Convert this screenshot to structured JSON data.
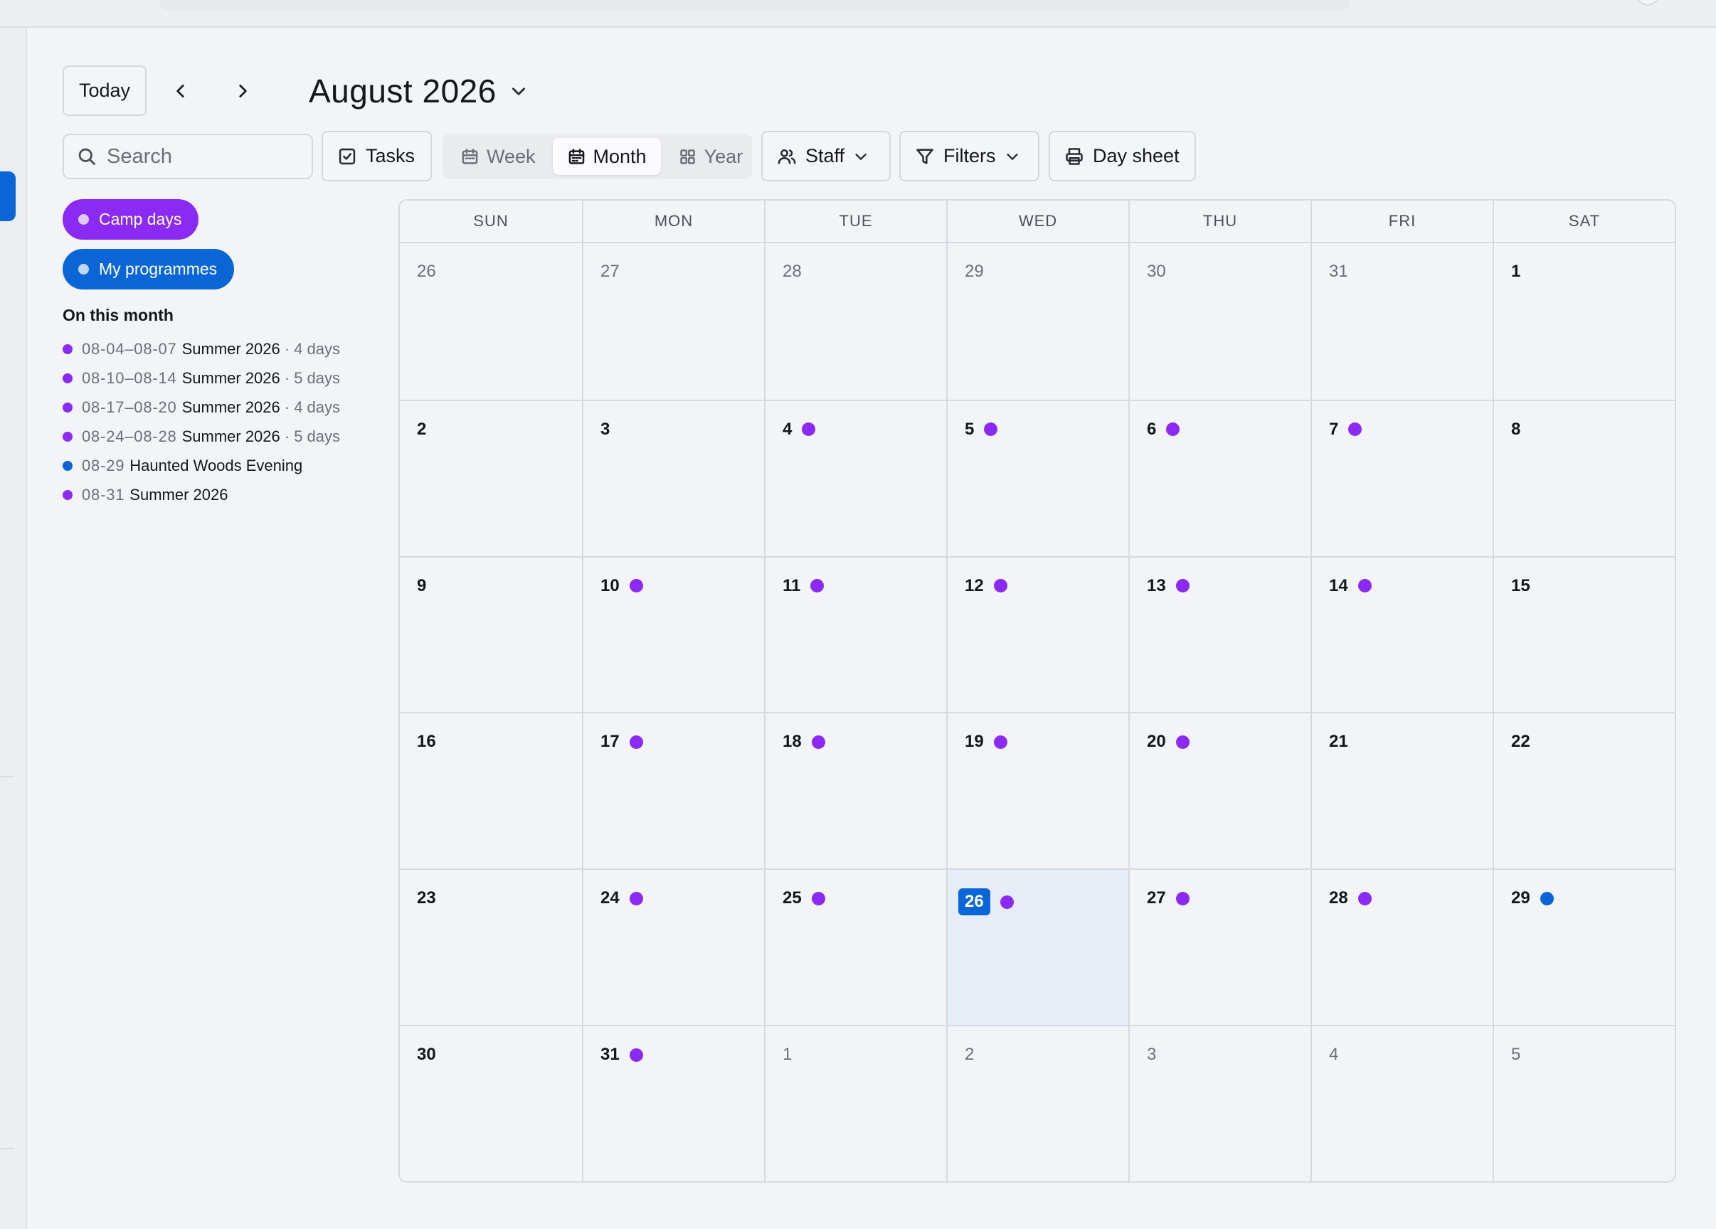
{
  "toolbar": {
    "today_label": "Today",
    "month_title": "August 2026",
    "search_placeholder": "Search",
    "tasks_label": "Tasks",
    "views": [
      {
        "label": "Week",
        "icon": "calendar-week-icon",
        "active": false
      },
      {
        "label": "Month",
        "icon": "calendar-month-icon",
        "active": true
      },
      {
        "label": "Year",
        "icon": "grid-icon",
        "active": false
      }
    ],
    "staff_label": "Staff",
    "filters_label": "Filters",
    "daysheet_label": "Day sheet"
  },
  "legend": {
    "camp_days": "Camp days",
    "my_programmes": "My programmes"
  },
  "month_list": {
    "title": "On this month",
    "items": [
      {
        "date": "08-04–08-07",
        "name": "Summer 2026",
        "length": "· 4 days",
        "kind": "camp"
      },
      {
        "date": "08-10–08-14",
        "name": "Summer 2026",
        "length": "· 5 days",
        "kind": "camp"
      },
      {
        "date": "08-17–08-20",
        "name": "Summer 2026",
        "length": "· 4 days",
        "kind": "camp"
      },
      {
        "date": "08-24–08-28",
        "name": "Summer 2026",
        "length": "· 5 days",
        "kind": "camp"
      },
      {
        "date": "08-29",
        "name": "Haunted Woods Evening",
        "length": "",
        "kind": "programme"
      },
      {
        "date": "08-31",
        "name": "Summer 2026",
        "length": "",
        "kind": "camp"
      }
    ]
  },
  "colors": {
    "camp": "#8b2af2",
    "programme": "#0a66d6",
    "today_highlight": "#0a66d6"
  },
  "calendar": {
    "weekdays": [
      "SUN",
      "MON",
      "TUE",
      "WED",
      "THU",
      "FRI",
      "SAT"
    ],
    "days": [
      {
        "num": "26",
        "in_month": false,
        "dot": null
      },
      {
        "num": "27",
        "in_month": false,
        "dot": null
      },
      {
        "num": "28",
        "in_month": false,
        "dot": null
      },
      {
        "num": "29",
        "in_month": false,
        "dot": null
      },
      {
        "num": "30",
        "in_month": false,
        "dot": null
      },
      {
        "num": "31",
        "in_month": false,
        "dot": null
      },
      {
        "num": "1",
        "in_month": true,
        "dot": null
      },
      {
        "num": "2",
        "in_month": true,
        "dot": null
      },
      {
        "num": "3",
        "in_month": true,
        "dot": null
      },
      {
        "num": "4",
        "in_month": true,
        "dot": "camp"
      },
      {
        "num": "5",
        "in_month": true,
        "dot": "camp"
      },
      {
        "num": "6",
        "in_month": true,
        "dot": "camp"
      },
      {
        "num": "7",
        "in_month": true,
        "dot": "camp"
      },
      {
        "num": "8",
        "in_month": true,
        "dot": null
      },
      {
        "num": "9",
        "in_month": true,
        "dot": null
      },
      {
        "num": "10",
        "in_month": true,
        "dot": "camp"
      },
      {
        "num": "11",
        "in_month": true,
        "dot": "camp"
      },
      {
        "num": "12",
        "in_month": true,
        "dot": "camp"
      },
      {
        "num": "13",
        "in_month": true,
        "dot": "camp"
      },
      {
        "num": "14",
        "in_month": true,
        "dot": "camp"
      },
      {
        "num": "15",
        "in_month": true,
        "dot": null
      },
      {
        "num": "16",
        "in_month": true,
        "dot": null
      },
      {
        "num": "17",
        "in_month": true,
        "dot": "camp"
      },
      {
        "num": "18",
        "in_month": true,
        "dot": "camp"
      },
      {
        "num": "19",
        "in_month": true,
        "dot": "camp"
      },
      {
        "num": "20",
        "in_month": true,
        "dot": "camp"
      },
      {
        "num": "21",
        "in_month": true,
        "dot": null
      },
      {
        "num": "22",
        "in_month": true,
        "dot": null
      },
      {
        "num": "23",
        "in_month": true,
        "dot": null
      },
      {
        "num": "24",
        "in_month": true,
        "dot": "camp"
      },
      {
        "num": "25",
        "in_month": true,
        "dot": "camp"
      },
      {
        "num": "26",
        "in_month": true,
        "dot": "camp",
        "today": true
      },
      {
        "num": "27",
        "in_month": true,
        "dot": "camp"
      },
      {
        "num": "28",
        "in_month": true,
        "dot": "camp"
      },
      {
        "num": "29",
        "in_month": true,
        "dot": "programme"
      },
      {
        "num": "30",
        "in_month": true,
        "dot": null
      },
      {
        "num": "31",
        "in_month": true,
        "dot": "camp"
      },
      {
        "num": "1",
        "in_month": false,
        "dot": null
      },
      {
        "num": "2",
        "in_month": false,
        "dot": null
      },
      {
        "num": "3",
        "in_month": false,
        "dot": null
      },
      {
        "num": "4",
        "in_month": false,
        "dot": null
      },
      {
        "num": "5",
        "in_month": false,
        "dot": null
      }
    ]
  }
}
